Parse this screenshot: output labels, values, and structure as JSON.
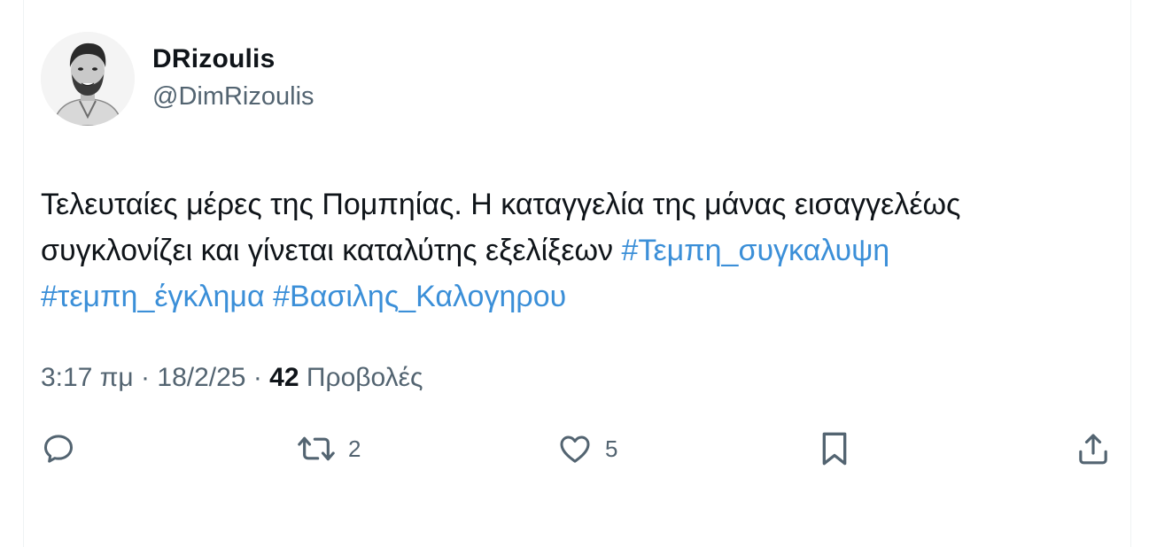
{
  "author": {
    "display_name": "DRizoulis",
    "handle": "@DimRizoulis"
  },
  "tweet": {
    "text_before": "Τελευταίες μέρες της Πομπηίας. Η καταγγελία της μάνας εισαγγελέως συγκλονίζει και γίνεται καταλύτης εξελίξεων ",
    "hashtags": [
      "#Τεμπη_συγκαλυψη",
      "#τεμπη_έγκλημα",
      "#Βασιλης_Καλογηρου"
    ]
  },
  "meta": {
    "time": "3:17 πμ",
    "separator": " · ",
    "date": "18/2/25",
    "views_count": "42",
    "views_label": " Προβολές"
  },
  "actions": {
    "reply_icon": "reply-icon",
    "retweet_count": "2",
    "like_count": "5",
    "bookmark_icon": "bookmark-icon",
    "share_icon": "share-icon"
  },
  "colors": {
    "text": "#0f1419",
    "secondary": "#536471",
    "link": "#3b8fd8"
  }
}
